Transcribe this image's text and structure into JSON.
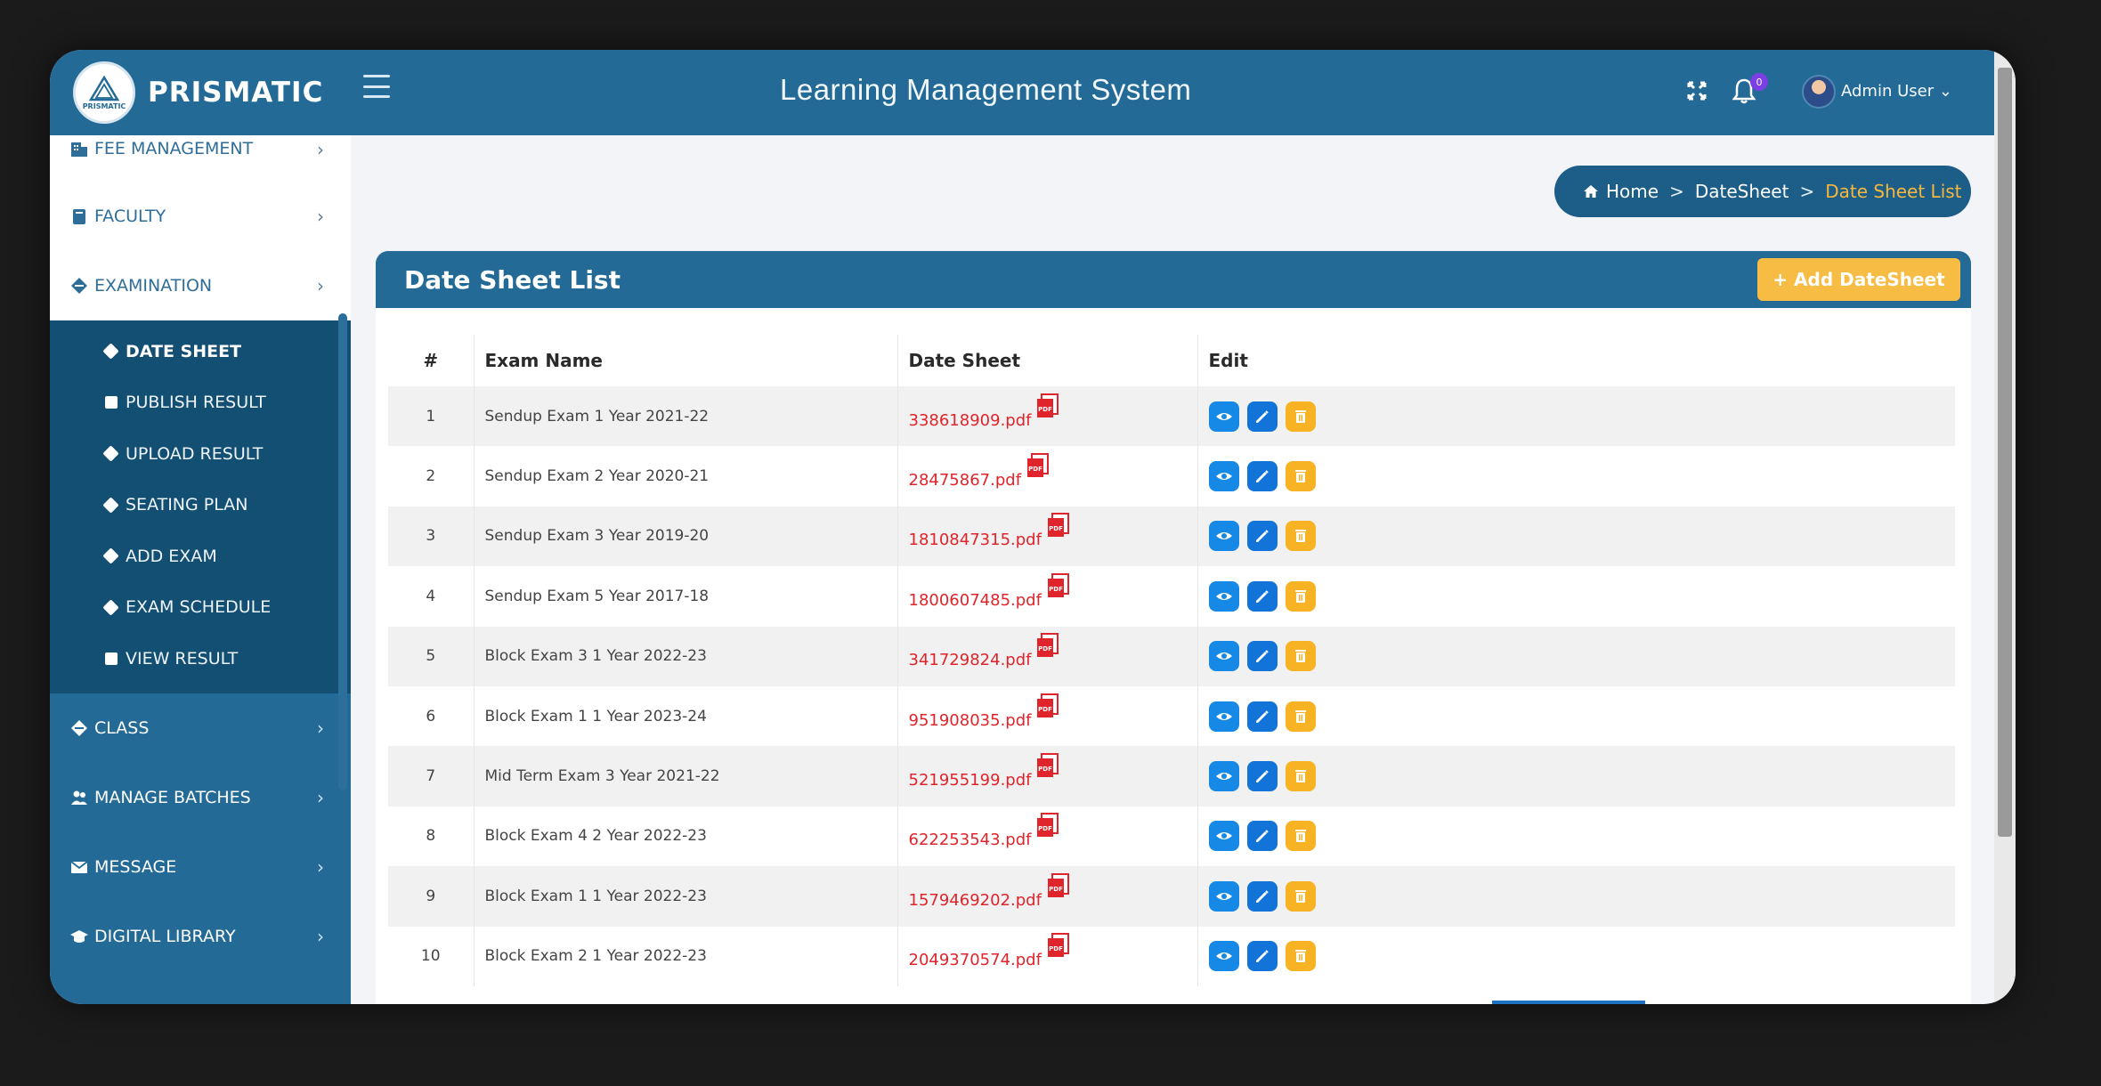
{
  "brand": {
    "name": "PRISMATIC",
    "logo_text": "PRISMATIC"
  },
  "header": {
    "title": "Learning Management System",
    "notifications_count": "0",
    "user_name": "Admin User",
    "user_caret": "⌄"
  },
  "sidebar": {
    "items_top": [
      {
        "label": "FEE MANAGEMENT",
        "icon": "building-icon"
      },
      {
        "label": "FACULTY",
        "icon": "book-icon"
      },
      {
        "label": "EXAMINATION",
        "icon": "diamond-icon"
      }
    ],
    "submenu": [
      {
        "label": "DATE SHEET",
        "icon": "diamond",
        "active": true
      },
      {
        "label": "PUBLISH RESULT",
        "icon": "square",
        "active": false
      },
      {
        "label": "UPLOAD RESULT",
        "icon": "diamond",
        "active": false
      },
      {
        "label": "SEATING PLAN",
        "icon": "diamond",
        "active": false
      },
      {
        "label": "ADD EXAM",
        "icon": "diamond",
        "active": false
      },
      {
        "label": "EXAM SCHEDULE",
        "icon": "diamond",
        "active": false
      },
      {
        "label": "VIEW RESULT",
        "icon": "square",
        "active": false
      }
    ],
    "items_bottom": [
      {
        "label": "CLASS",
        "icon": "diamond-icon"
      },
      {
        "label": "MANAGE BATCHES",
        "icon": "users-icon"
      },
      {
        "label": "MESSAGE",
        "icon": "envelope-icon"
      },
      {
        "label": "DIGITAL LIBRARY",
        "icon": "graduation-cap-icon"
      }
    ],
    "chevron": "›"
  },
  "breadcrumb": {
    "home": "Home",
    "section": "DateSheet",
    "current": "Date Sheet List",
    "separator": ">"
  },
  "card": {
    "title": "Date Sheet List",
    "add_button": "+ Add DateSheet"
  },
  "table": {
    "headers": [
      "#",
      "Exam Name",
      "Date Sheet",
      "Edit"
    ],
    "rows": [
      {
        "n": "1",
        "exam": "Sendup Exam 1 Year 2021-22",
        "file": "338618909.pdf"
      },
      {
        "n": "2",
        "exam": "Sendup Exam 2 Year 2020-21",
        "file": "28475867.pdf"
      },
      {
        "n": "3",
        "exam": "Sendup Exam 3 Year 2019-20",
        "file": "1810847315.pdf"
      },
      {
        "n": "4",
        "exam": "Sendup Exam 5 Year 2017-18",
        "file": "1800607485.pdf"
      },
      {
        "n": "5",
        "exam": "Block Exam 3 1 Year 2022-23",
        "file": "341729824.pdf"
      },
      {
        "n": "6",
        "exam": "Block Exam 1 1 Year 2023-24",
        "file": "951908035.pdf"
      },
      {
        "n": "7",
        "exam": "Mid Term Exam 3 Year 2021-22",
        "file": "521955199.pdf"
      },
      {
        "n": "8",
        "exam": "Block Exam 4 2 Year 2022-23",
        "file": "622253543.pdf"
      },
      {
        "n": "9",
        "exam": "Block Exam 1 1 Year 2022-23",
        "file": "1579469202.pdf"
      },
      {
        "n": "10",
        "exam": "Block Exam 2 1 Year 2022-23",
        "file": "2049370574.pdf"
      }
    ]
  },
  "colors": {
    "primary": "#236a97",
    "submenu_bg": "#134e73",
    "accent": "#f6bc43",
    "pdf_link": "#e0242b",
    "view_btn": "#1689e6",
    "edit_btn": "#1274d8",
    "delete_btn": "#f7b323"
  }
}
